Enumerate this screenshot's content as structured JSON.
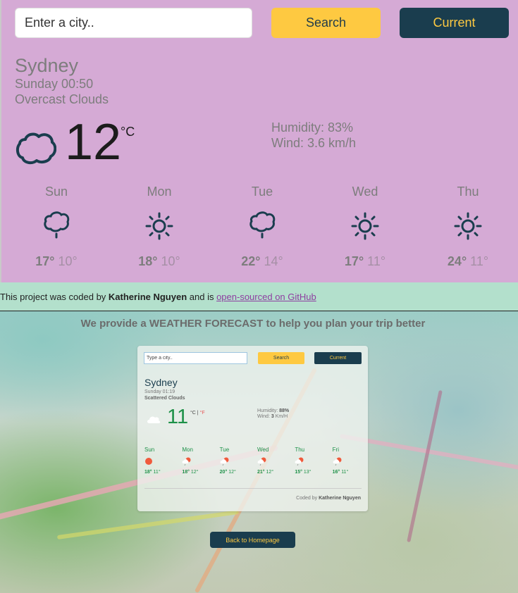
{
  "search": {
    "placeholder": "Enter a city..",
    "search_label": "Search",
    "current_label": "Current"
  },
  "current": {
    "city": "Sydney",
    "datetime": "Sunday 00:50",
    "description": "Overcast Clouds",
    "icon": "cloud-icon",
    "temperature": "12",
    "unit": "°C",
    "humidity": "Humidity: 83%",
    "wind": "Wind: 3.6 km/h"
  },
  "forecast": [
    {
      "day": "Sun",
      "icon": "rain-cloud-icon",
      "max": "17°",
      "min": "10°"
    },
    {
      "day": "Mon",
      "icon": "sun-icon",
      "max": "18°",
      "min": "10°"
    },
    {
      "day": "Tue",
      "icon": "rain-cloud-icon",
      "max": "22°",
      "min": "14°"
    },
    {
      "day": "Wed",
      "icon": "sun-icon",
      "max": "17°",
      "min": "11°"
    },
    {
      "day": "Thu",
      "icon": "sun-icon",
      "max": "24°",
      "min": "11°"
    }
  ],
  "footer": {
    "prefix": "This project was coded by ",
    "author": "Katherine Nguyen",
    "middle": " and is ",
    "link": "open-sourced on GitHub"
  },
  "screenshot": {
    "title": "We provide a WEATHER FORECAST to help you plan your trip better",
    "placeholder": "Type a city..",
    "search_label": "Search",
    "current_label": "Current",
    "city": "Sydney",
    "datetime": "Sunday 01:19",
    "description": "Scattered Clouds",
    "temperature": "11",
    "unit_c": "°C",
    "unit_sep": " | ",
    "unit_f": "°F",
    "humidity_label": "Humidity: ",
    "humidity_value": "88%",
    "wind_label": "Wind: ",
    "wind_value": "3",
    "wind_unit": " Km/H",
    "forecast": [
      {
        "day": "Sun",
        "icon": "sun-icon",
        "max": "18°",
        "min": "11°"
      },
      {
        "day": "Mon",
        "icon": "sun-rain-cloud-icon",
        "max": "18°",
        "min": "12°"
      },
      {
        "day": "Tue",
        "icon": "sun-rain-cloud-icon",
        "max": "20°",
        "min": "12°"
      },
      {
        "day": "Wed",
        "icon": "sun-rain-cloud-icon",
        "max": "21°",
        "min": "12°"
      },
      {
        "day": "Thu",
        "icon": "sun-rain-cloud-icon",
        "max": "15°",
        "min": "13°"
      },
      {
        "day": "Fri",
        "icon": "sun-rain-cloud-icon",
        "max": "16°",
        "min": "11°"
      }
    ],
    "credit_prefix": "Coded by ",
    "credit_author": "Katherine Nguyen",
    "back_label": "Back to Homepage"
  }
}
